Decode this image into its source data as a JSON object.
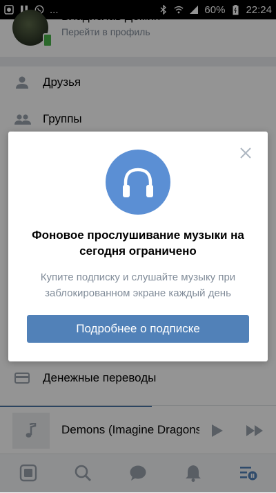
{
  "status_bar": {
    "left_icons": [
      "app-notification-icon",
      "pause-icon",
      "viber-icon"
    ],
    "ellipsis": "...",
    "battery": "60%",
    "time": "22:24"
  },
  "profile": {
    "name": "Владислав Демин",
    "link": "Перейти в профиль"
  },
  "menu": {
    "items": [
      {
        "label": "Друзья",
        "icon": "person-icon"
      },
      {
        "label": "Группы",
        "icon": "people-icon"
      },
      {
        "label": "Денежные переводы",
        "icon": "card-icon"
      }
    ]
  },
  "player": {
    "title": "Demons (Imagine Dragons)"
  },
  "tabbar": {
    "tabs": [
      "news-icon",
      "search-icon",
      "messages-icon",
      "notifications-icon",
      "menu-icon"
    ]
  },
  "modal": {
    "title": "Фоновое прослушивание музыки на сегодня ограничено",
    "text": "Купите подписку и слушайте музыку при заблокированном экране каждый день",
    "button": "Подробнее о подписке"
  },
  "colors": {
    "accent": "#5181b8",
    "icon_circle": "#5b8fd4",
    "secondary_text": "#818c99"
  }
}
